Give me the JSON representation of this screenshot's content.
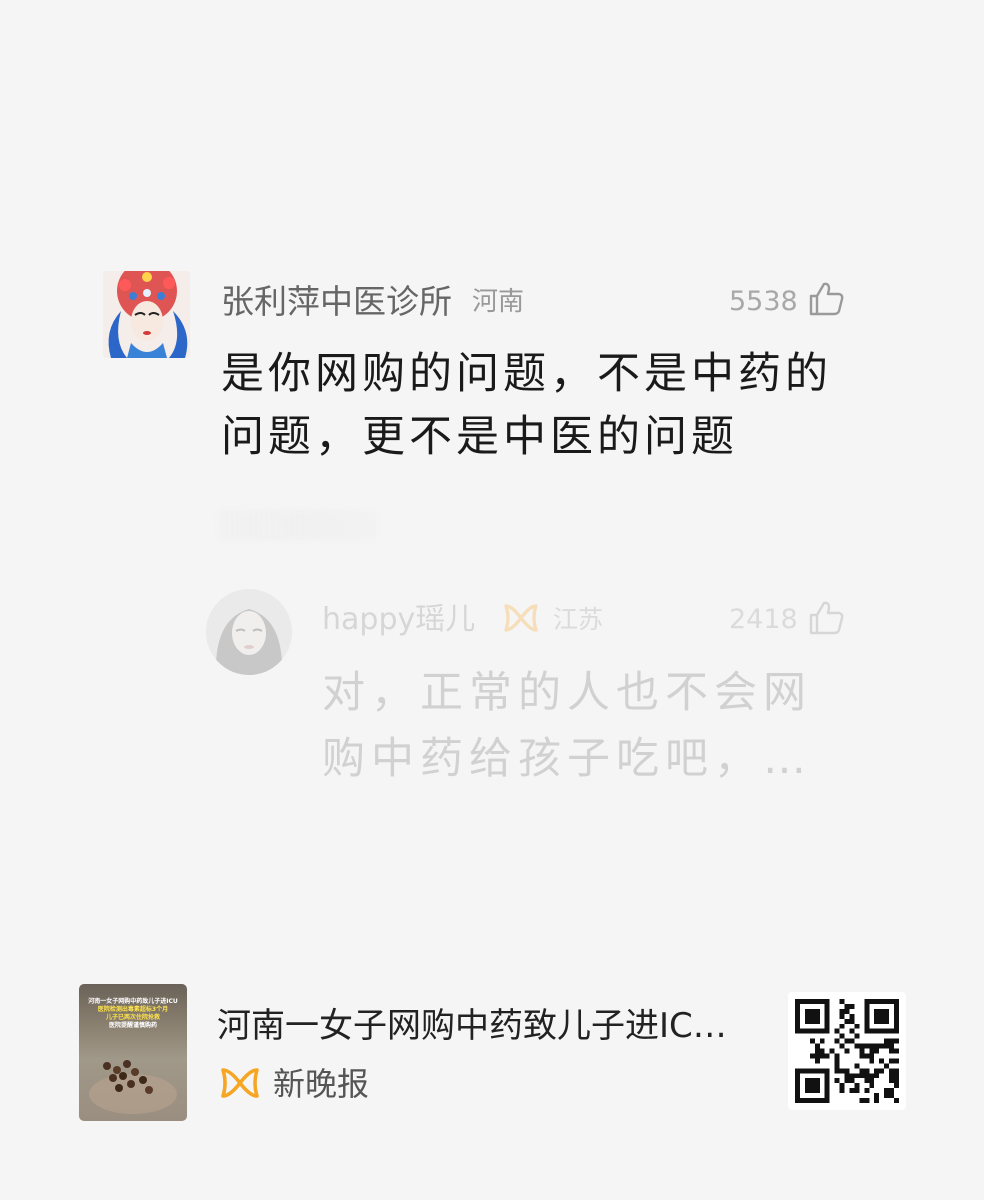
{
  "main_comment": {
    "author": "张利萍中医诊所",
    "location": "河南",
    "like_count": "5538",
    "text": "是你网购的问题，不是中药的问题，更不是中医的问题",
    "avatar_icon": "opera-portrait-avatar",
    "like_icon": "thumbs-up-icon"
  },
  "reply_comment": {
    "author": "happy瑶儿",
    "vip_icon": "vip-badge-icon",
    "location": "江苏",
    "like_count": "2418",
    "text": "对，正常的人也不会网购中药给孩子吃吧，…",
    "avatar_icon": "woman-portrait-avatar",
    "like_icon": "thumbs-up-icon"
  },
  "article_card": {
    "title": "河南一女子网购中药致儿子进IC…",
    "source": "新晚报",
    "source_icon": "brand-logo-icon",
    "source_icon_color": "#f5a623",
    "thumbnail_lines": [
      "河南一女子网购中药致儿子进ICU",
      "医院检测出毒素超标3个月",
      "儿子已两次住院抢救",
      "医院提醒谨慎购药"
    ],
    "qr_icon": "qr-code-icon"
  },
  "colors": {
    "background": "#f5f5f5",
    "text_primary": "#1a1a1a",
    "text_secondary": "#666666",
    "accent": "#f5a623"
  }
}
